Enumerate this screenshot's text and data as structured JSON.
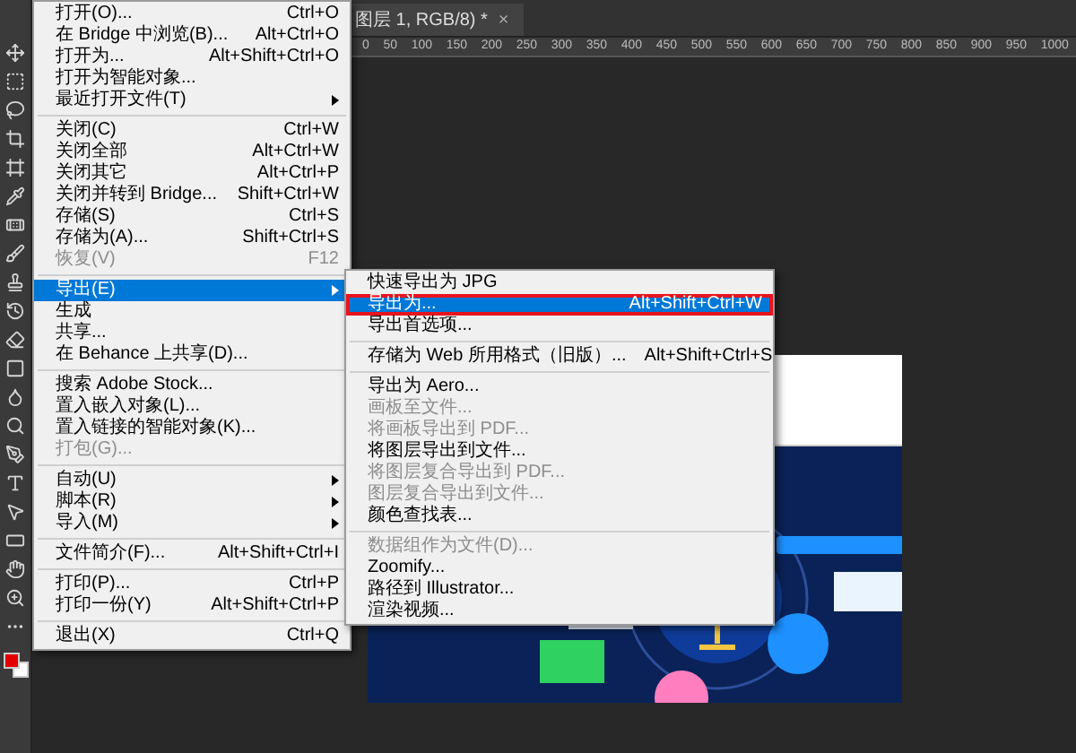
{
  "document_tab": {
    "title": "图层 1, RGB/8) *",
    "close": "×"
  },
  "ruler": [
    "0",
    "50",
    "100",
    "150",
    "200",
    "250",
    "300",
    "350",
    "400",
    "450",
    "500",
    "550",
    "600",
    "650",
    "700",
    "750",
    "800",
    "850",
    "900",
    "950",
    "1000"
  ],
  "file_menu": {
    "groups": [
      {
        "items": [
          {
            "label": "打开(O)...",
            "shortcut": "Ctrl+O",
            "submenu": false,
            "disabled": false,
            "selected": false
          },
          {
            "label": "在 Bridge 中浏览(B)...",
            "shortcut": "Alt+Ctrl+O",
            "submenu": false,
            "disabled": false,
            "selected": false
          },
          {
            "label": "打开为...",
            "shortcut": "Alt+Shift+Ctrl+O",
            "submenu": false,
            "disabled": false,
            "selected": false
          },
          {
            "label": "打开为智能对象...",
            "submenu": false,
            "disabled": false,
            "selected": false
          },
          {
            "label": "最近打开文件(T)",
            "submenu": true,
            "disabled": false,
            "selected": false
          }
        ]
      },
      {
        "items": [
          {
            "label": "关闭(C)",
            "shortcut": "Ctrl+W",
            "submenu": false,
            "disabled": false,
            "selected": false
          },
          {
            "label": "关闭全部",
            "shortcut": "Alt+Ctrl+W",
            "submenu": false,
            "disabled": false,
            "selected": false
          },
          {
            "label": "关闭其它",
            "shortcut": "Alt+Ctrl+P",
            "submenu": false,
            "disabled": false,
            "selected": false
          },
          {
            "label": "关闭并转到 Bridge...",
            "shortcut": "Shift+Ctrl+W",
            "submenu": false,
            "disabled": false,
            "selected": false
          },
          {
            "label": "存储(S)",
            "shortcut": "Ctrl+S",
            "submenu": false,
            "disabled": false,
            "selected": false
          },
          {
            "label": "存储为(A)...",
            "shortcut": "Shift+Ctrl+S",
            "submenu": false,
            "disabled": false,
            "selected": false
          },
          {
            "label": "恢复(V)",
            "shortcut": "F12",
            "submenu": false,
            "disabled": true,
            "selected": false
          }
        ]
      },
      {
        "items": [
          {
            "label": "导出(E)",
            "submenu": true,
            "disabled": false,
            "selected": true
          },
          {
            "label": "生成",
            "submenu": false,
            "disabled": false,
            "selected": false
          },
          {
            "label": "共享...",
            "submenu": false,
            "disabled": false,
            "selected": false
          },
          {
            "label": "在 Behance 上共享(D)...",
            "submenu": false,
            "disabled": false,
            "selected": false
          }
        ]
      },
      {
        "items": [
          {
            "label": "搜索 Adobe Stock...",
            "submenu": false,
            "disabled": false,
            "selected": false
          },
          {
            "label": "置入嵌入对象(L)...",
            "submenu": false,
            "disabled": false,
            "selected": false
          },
          {
            "label": "置入链接的智能对象(K)...",
            "submenu": false,
            "disabled": false,
            "selected": false
          },
          {
            "label": "打包(G)...",
            "submenu": false,
            "disabled": true,
            "selected": false
          }
        ]
      },
      {
        "items": [
          {
            "label": "自动(U)",
            "submenu": true,
            "disabled": false,
            "selected": false
          },
          {
            "label": "脚本(R)",
            "submenu": true,
            "disabled": false,
            "selected": false
          },
          {
            "label": "导入(M)",
            "submenu": true,
            "disabled": false,
            "selected": false
          }
        ]
      },
      {
        "items": [
          {
            "label": "文件简介(F)...",
            "shortcut": "Alt+Shift+Ctrl+I",
            "submenu": false,
            "disabled": false,
            "selected": false
          }
        ]
      },
      {
        "items": [
          {
            "label": "打印(P)...",
            "shortcut": "Ctrl+P",
            "submenu": false,
            "disabled": false,
            "selected": false
          },
          {
            "label": "打印一份(Y)",
            "shortcut": "Alt+Shift+Ctrl+P",
            "submenu": false,
            "disabled": false,
            "selected": false
          }
        ]
      },
      {
        "items": [
          {
            "label": "退出(X)",
            "shortcut": "Ctrl+Q",
            "submenu": false,
            "disabled": false,
            "selected": false
          }
        ]
      }
    ]
  },
  "export_menu": {
    "groups": [
      {
        "items": [
          {
            "label": "快速导出为 JPG",
            "disabled": false,
            "selected": false,
            "highlighted": false
          },
          {
            "label": "导出为...",
            "shortcut": "Alt+Shift+Ctrl+W",
            "disabled": false,
            "selected": true,
            "highlighted": true
          },
          {
            "label": "导出首选项...",
            "disabled": false,
            "selected": false,
            "highlighted": false
          }
        ]
      },
      {
        "items": [
          {
            "label": "存储为 Web 所用格式（旧版）...",
            "shortcut": "Alt+Shift+Ctrl+S",
            "disabled": false,
            "selected": false,
            "highlighted": false
          }
        ]
      },
      {
        "items": [
          {
            "label": "导出为 Aero...",
            "disabled": false,
            "selected": false,
            "highlighted": false
          },
          {
            "label": "画板至文件...",
            "disabled": true,
            "selected": false,
            "highlighted": false
          },
          {
            "label": "将画板导出到 PDF...",
            "disabled": true,
            "selected": false,
            "highlighted": false
          },
          {
            "label": "将图层导出到文件...",
            "disabled": false,
            "selected": false,
            "highlighted": false
          },
          {
            "label": "将图层复合导出到 PDF...",
            "disabled": true,
            "selected": false,
            "highlighted": false
          },
          {
            "label": "图层复合导出到文件...",
            "disabled": true,
            "selected": false,
            "highlighted": false
          },
          {
            "label": "颜色查找表...",
            "disabled": false,
            "selected": false,
            "highlighted": false
          }
        ]
      },
      {
        "items": [
          {
            "label": "数据组作为文件(D)...",
            "disabled": true,
            "selected": false,
            "highlighted": false
          },
          {
            "label": "Zoomify...",
            "disabled": false,
            "selected": false,
            "highlighted": false
          },
          {
            "label": "路径到 Illustrator...",
            "disabled": false,
            "selected": false,
            "highlighted": false
          },
          {
            "label": "渲染视频...",
            "disabled": false,
            "selected": false,
            "highlighted": false
          }
        ]
      }
    ]
  }
}
